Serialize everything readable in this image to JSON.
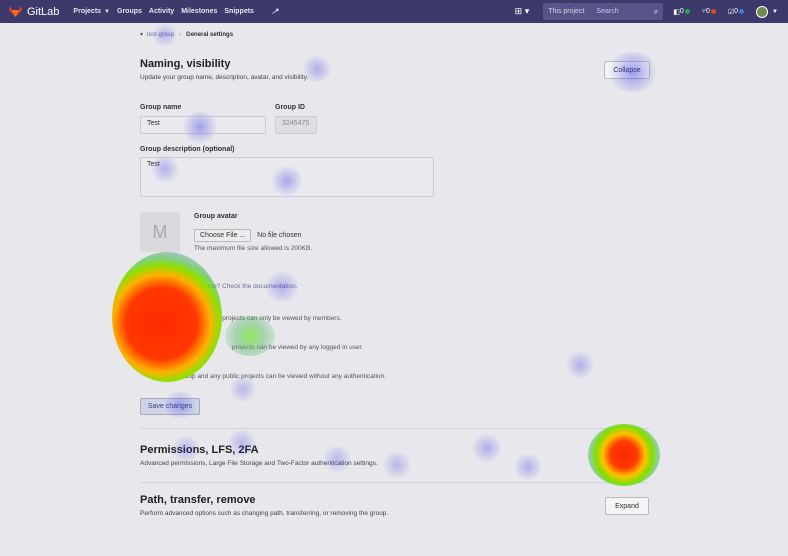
{
  "navbar": {
    "brand": "GitLab",
    "links": [
      {
        "label": "Projects",
        "has_caret": true
      },
      {
        "label": "Groups",
        "has_caret": false
      },
      {
        "label": "Activity",
        "has_caret": false
      },
      {
        "label": "Milestones",
        "has_caret": false
      },
      {
        "label": "Snippets",
        "has_caret": false
      }
    ],
    "extra_icon": "chart-icon",
    "plus_icon": "plus-square-icon",
    "search": {
      "scope": "This project",
      "placeholder": "Search",
      "icon": "search-icon"
    },
    "counters": [
      {
        "value": "0",
        "color": "#28a745",
        "icon": "issues-icon"
      },
      {
        "value": "0",
        "color": "#e24329",
        "icon": "merge-request-icon"
      },
      {
        "value": "0",
        "color": "#3a7bd5",
        "icon": "todo-icon"
      }
    ],
    "avatar_icon": "user-avatar-icon"
  },
  "breadcrumb": {
    "parent": "test-group",
    "current": "General settings"
  },
  "naming": {
    "title": "Naming, visibility",
    "description": "Update your group name, description, avatar, and visibility.",
    "collapse_label": "Collapse",
    "group_name_label": "Group name",
    "group_name_value": "Test",
    "group_id_label": "Group ID",
    "group_id_value": "3245475",
    "description_label": "Group description (optional)",
    "description_value": "Test",
    "avatar_label": "Group avatar",
    "avatar_placeholder": "M",
    "choose_file_label": "Choose File ...",
    "no_file_text": "No file chosen",
    "max_size_text": "The maximum file size allowed is 200KB.",
    "visibility_help_suffix": "group? Check the documentation.",
    "visibility_private_tail": "its projects can only be viewed by members.",
    "visibility_internal_tail": "projects can be viewed by any logged in user.",
    "visibility_public_label": "Public",
    "visibility_public_desc": "The group and any public projects can be viewed without any authentication.",
    "save_label": "Save changes"
  },
  "permissions": {
    "title": "Permissions, LFS, 2FA",
    "description": "Advanced permissions, Large File Storage and Two-Factor authentication settings."
  },
  "path": {
    "title": "Path, transfer, remove",
    "description": "Perform advanced options such as changing path, transferring, or removing the group.",
    "expand_label": "Expand"
  }
}
